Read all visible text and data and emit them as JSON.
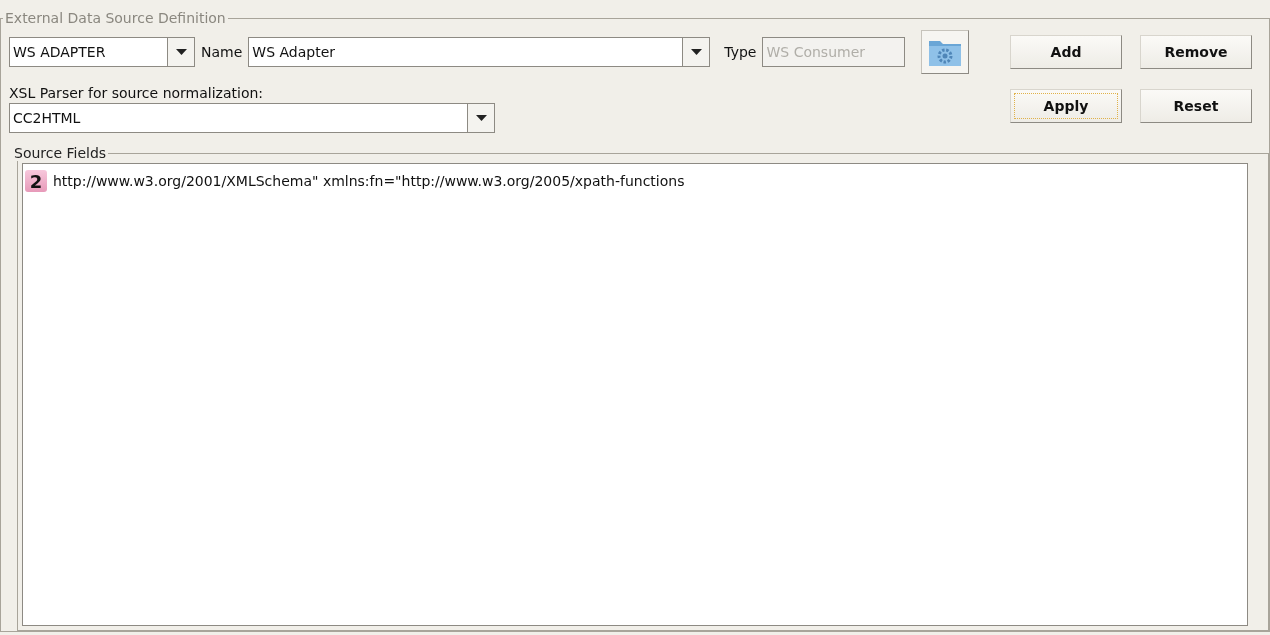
{
  "panel": {
    "title": "External Data Source Definition"
  },
  "source_combo": {
    "value": "WS ADAPTER"
  },
  "name_field": {
    "label": "Name",
    "value": "WS Adapter"
  },
  "type_field": {
    "label": "Type",
    "value": "WS Consumer",
    "disabled": true
  },
  "parser": {
    "label": "XSL Parser for source normalization:",
    "value": "CC2HTML"
  },
  "buttons": [
    {
      "label": "Add",
      "focused": false
    },
    {
      "label": "Remove",
      "focused": false
    },
    {
      "label": "Apply",
      "focused": true
    },
    {
      "label": "Reset",
      "focused": false
    }
  ],
  "source_fields": {
    "title": "Source Fields",
    "items": [
      {
        "badge": "2",
        "text": "http://www.w3.org/2001/XMLSchema\" xmlns:fn=\"http://www.w3.org/2005/xpath-functions"
      }
    ]
  }
}
